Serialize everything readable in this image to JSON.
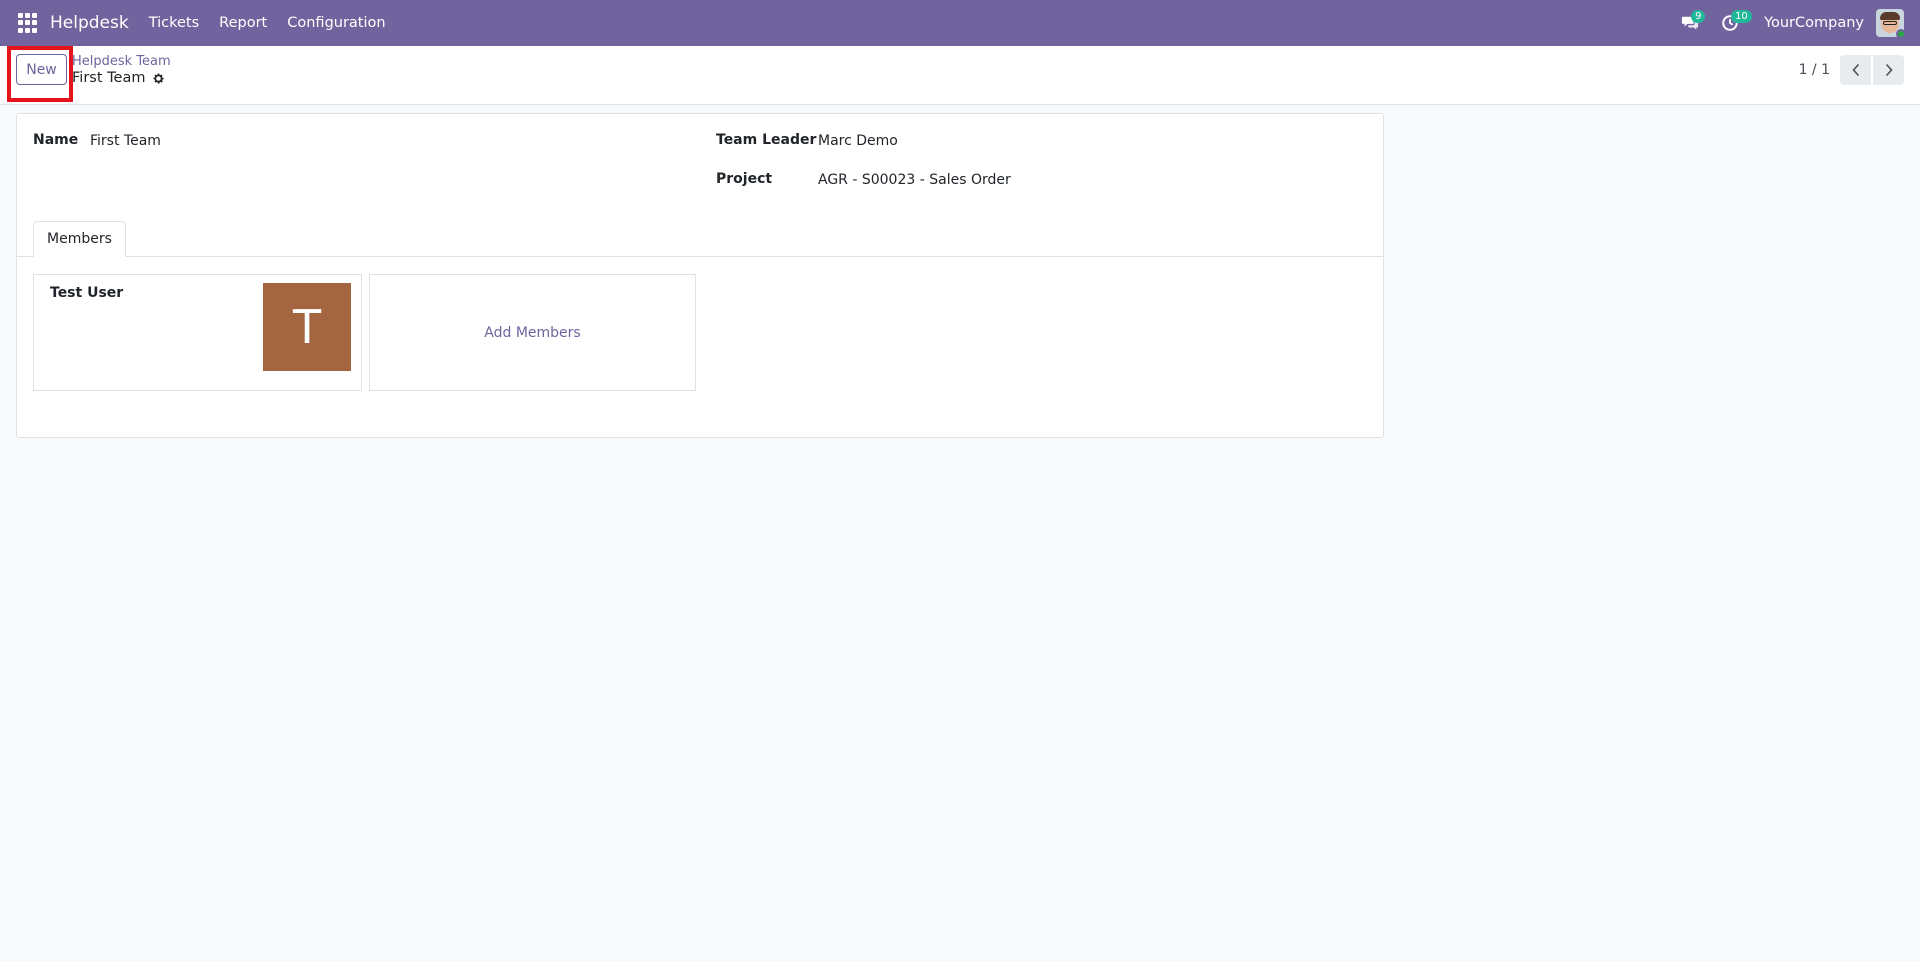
{
  "navbar": {
    "brand": "Helpdesk",
    "menu": [
      "Tickets",
      "Report",
      "Configuration"
    ],
    "messages_count": "9",
    "activities_count": "10",
    "company": "YourCompany",
    "bg_color": "#71639e"
  },
  "control_panel": {
    "new_label": "New",
    "breadcrumb_parent": "Helpdesk Team",
    "breadcrumb_current": "First Team",
    "pager_value": "1 / 1"
  },
  "form": {
    "name_label": "Name",
    "name_value": "First Team",
    "team_leader_label": "Team Leader",
    "team_leader_value": "Marc Demo",
    "project_label": "Project",
    "project_value": "AGR - S00023 - Sales Order",
    "tabs": [
      "Members"
    ],
    "members": [
      {
        "name": "Test User",
        "initial": "T",
        "avatar_color": "#a46641"
      }
    ],
    "add_members_label": "Add Members"
  }
}
